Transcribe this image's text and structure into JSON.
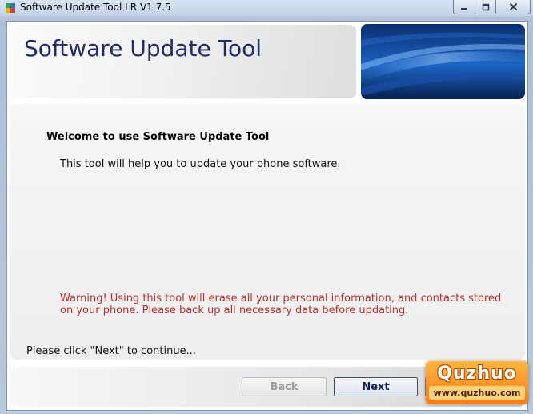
{
  "window": {
    "title": "Software Update Tool LR V1.7.5",
    "icon": "app-icon",
    "controls": [
      "minimize-icon",
      "maximize-icon",
      "close-icon"
    ]
  },
  "header": {
    "title": "Software Update Tool",
    "title_color": "#1f2b6b",
    "banner_color": "#0a3b83"
  },
  "content": {
    "welcome_title": "Welcome to use Software Update Tool",
    "intro": "This tool will help you to update your phone software.",
    "warning": "Warning! Using this tool will erase all your personal information, and contacts stored on your phone. Please back up all necessary data before updating.",
    "warning_color": "#c52a2a",
    "continue_hint": "Please click \"Next\" to continue..."
  },
  "footer": {
    "back_label": "Back",
    "back_enabled": false,
    "next_label": "Next",
    "cancel_label": ""
  },
  "watermark": {
    "logo": "Quzhuo",
    "url": "www.quzhuo.com"
  }
}
